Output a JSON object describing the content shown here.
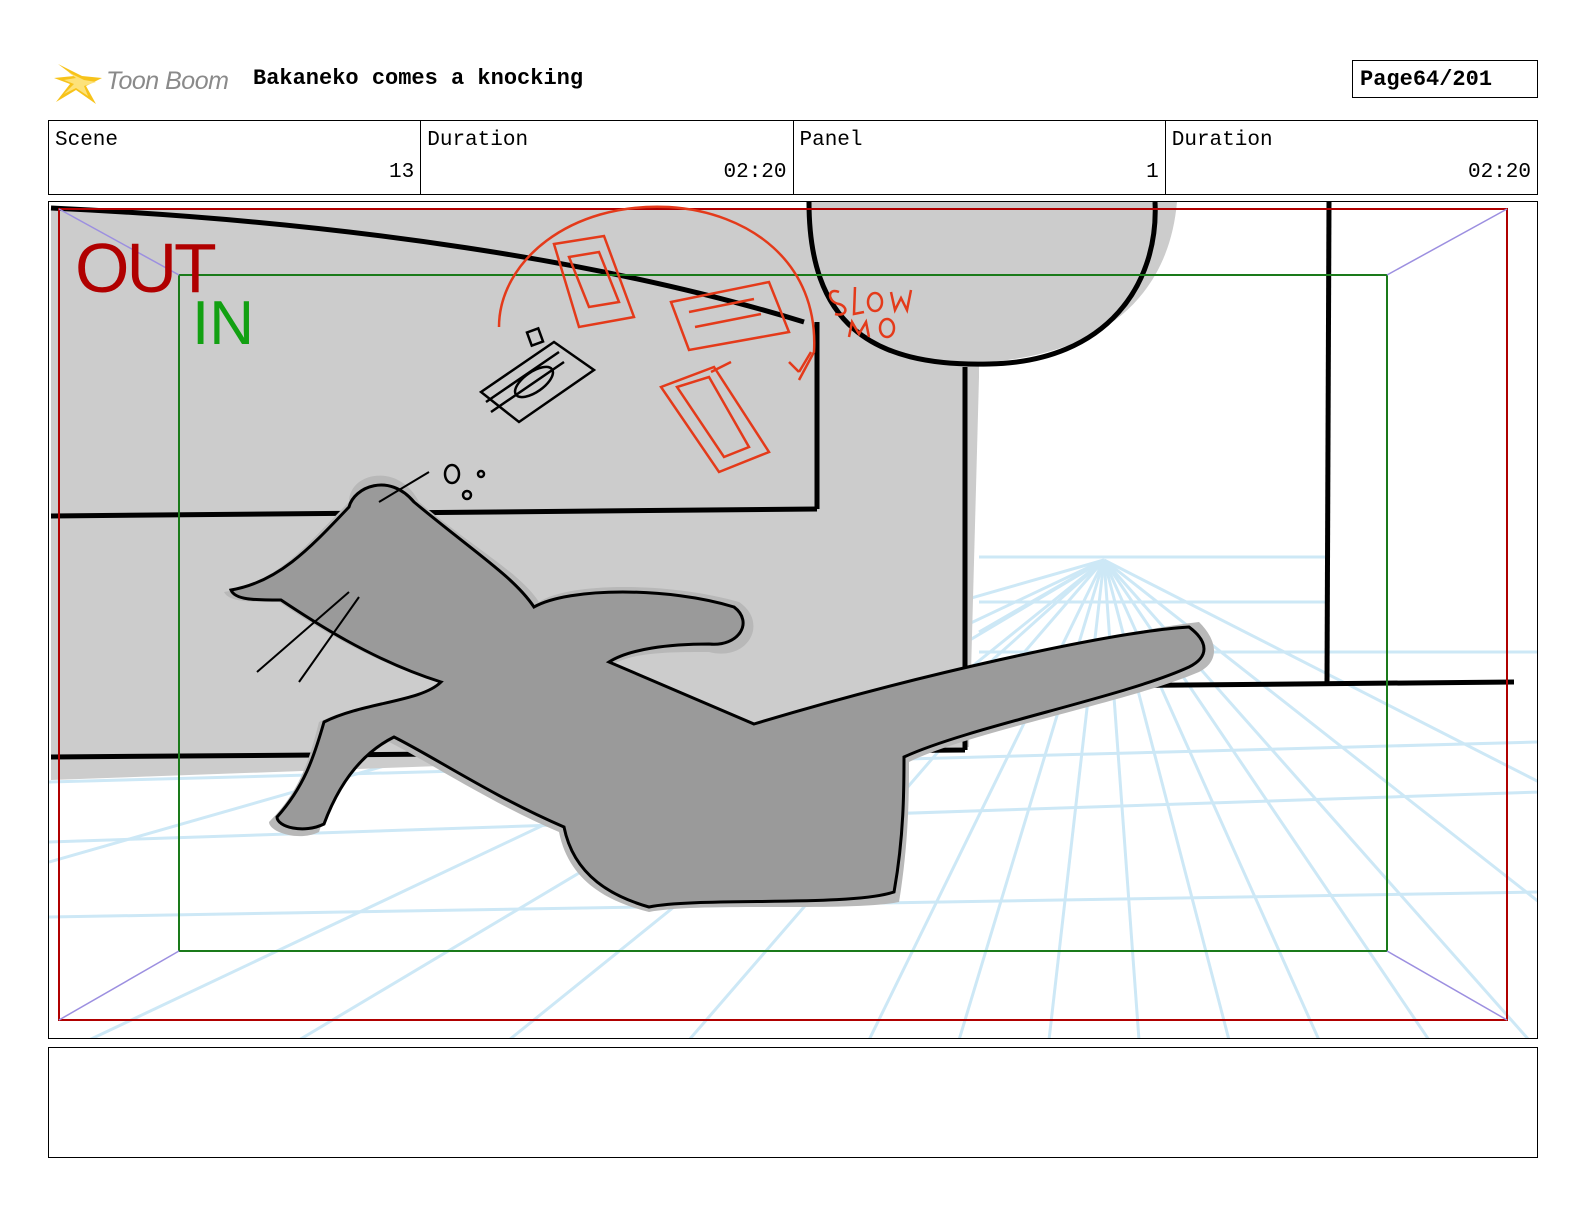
{
  "header": {
    "logo_text": "Toon Boom",
    "title": "Bakaneko comes a knocking",
    "page_label": "Page",
    "page_value": "64/201"
  },
  "info": {
    "scene_label": "Scene",
    "scene_value": "13",
    "duration_label": "Duration",
    "duration_value": "02:20",
    "panel_label": "Panel",
    "panel_value": "1",
    "panel_duration_label": "Duration",
    "panel_duration_value": "02:20"
  },
  "frame": {
    "out_label": "OUT",
    "in_label": "IN",
    "annotation": "slow mo"
  },
  "notes": {
    "text": ""
  },
  "colors": {
    "out_frame": "#b00000",
    "in_frame": "#12a012",
    "annotation": "#e43a1a",
    "perspective_grid": "#cde8f6",
    "wall": "#cccccc",
    "cat": "#9a9a9a"
  }
}
